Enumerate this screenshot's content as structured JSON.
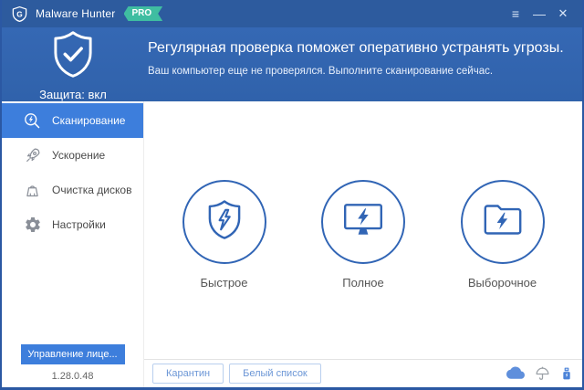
{
  "window": {
    "title": "Malware Hunter",
    "badge": "PRO",
    "controls": {
      "menu": "≡",
      "minimize": "—",
      "close": "✕"
    }
  },
  "header": {
    "protection_label": "Защита: вкл",
    "title": "Регулярная проверка поможет оперативно устранять угрозы.",
    "subtitle": "Ваш компьютер еще не проверялся. Выполните сканирование сейчас."
  },
  "sidebar": {
    "items": [
      {
        "label": "Сканирование",
        "icon": "scan-search-bolt-icon",
        "active": true
      },
      {
        "label": "Ускорение",
        "icon": "rocket-icon",
        "active": false
      },
      {
        "label": "Очистка дисков",
        "icon": "broom-icon",
        "active": false
      },
      {
        "label": "Настройки",
        "icon": "gear-icon",
        "active": false
      }
    ],
    "license_button": "Управление лице...",
    "version": "1.28.0.48"
  },
  "main": {
    "scan_options": [
      {
        "label": "Быстрое",
        "icon": "shield-bolt-icon"
      },
      {
        "label": "Полное",
        "icon": "monitor-bolt-icon"
      },
      {
        "label": "Выборочное",
        "icon": "folder-bolt-icon"
      }
    ]
  },
  "footer": {
    "quarantine_button": "Карантин",
    "whitelist_button": "Белый список",
    "icons": [
      "cloud-icon",
      "umbrella-icon",
      "usb-bolt-icon"
    ]
  },
  "colors": {
    "titlebar": "#2d5b9e",
    "header": "#3467b3",
    "accent": "#3d7edc",
    "pro_badge": "#3fbda1",
    "icon_blue": "#3165b5"
  }
}
